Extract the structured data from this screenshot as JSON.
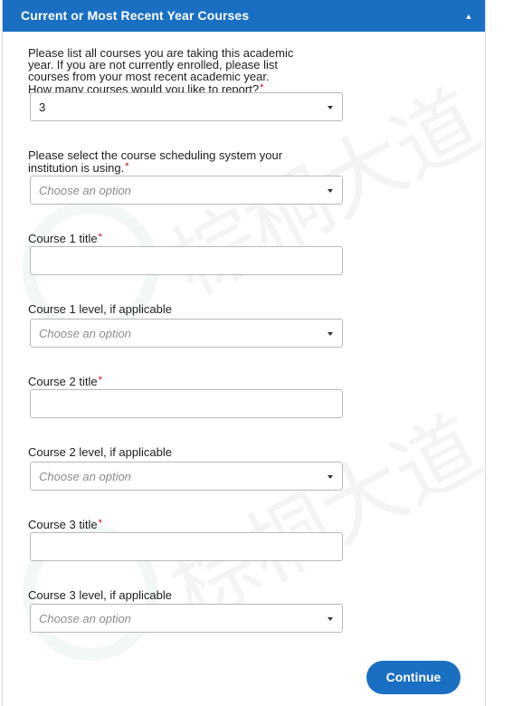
{
  "panel": {
    "title": "Current or Most Recent Year Courses",
    "collapse_icon": "chevron-up-icon",
    "header_color": "#1a6fc2"
  },
  "fields": {
    "num_courses": {
      "label_line1": "Please list all courses you are taking this academic",
      "label_line2": "year. If you are not currently enrolled, please list",
      "label_line3": "courses from your most recent academic year.",
      "label_line4": "How many courses would you like to report?",
      "required_mark": "*",
      "value": "3"
    },
    "scheduling_system": {
      "label_line1": "Please select the course scheduling system your",
      "label_line2": "institution is using.",
      "required_mark": "*",
      "placeholder": "Choose an option"
    },
    "course1_title": {
      "label": "Course 1 title",
      "required_mark": "*",
      "value": ""
    },
    "course1_level": {
      "label": "Course 1 level, if applicable",
      "placeholder": "Choose an option"
    },
    "course2_title": {
      "label": "Course 2 title",
      "required_mark": "*",
      "value": ""
    },
    "course2_level": {
      "label": "Course 2 level, if applicable",
      "placeholder": "Choose an option"
    },
    "course3_title": {
      "label": "Course 3 title",
      "required_mark": "*",
      "value": ""
    },
    "course3_level": {
      "label": "Course 3 level, if applicable",
      "placeholder": "Choose an option"
    }
  },
  "actions": {
    "continue_label": "Continue"
  },
  "watermark": {
    "text": "棕桐大道"
  },
  "colors": {
    "accent": "#1a6fc2",
    "required": "#d0021b"
  }
}
